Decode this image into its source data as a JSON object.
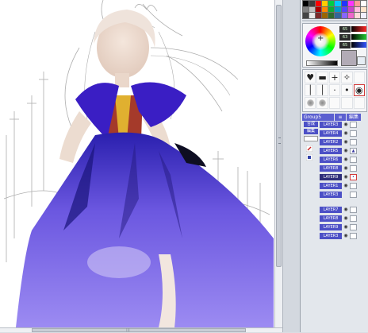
{
  "canvas": {
    "label": "illustration canvas"
  },
  "palette": {
    "swatches": [
      "#000000",
      "#3b3b3b",
      "#ff0000",
      "#ffcc00",
      "#00cc44",
      "#00c8ff",
      "#2233ff",
      "#ff33ff",
      "#ff9999",
      "#ffffff",
      "#808080",
      "#bfbfbf",
      "#aa0000",
      "#ff8800",
      "#11aa33",
      "#0099cc",
      "#5544ff",
      "#cc44cc",
      "#ffbbdd",
      "#ffe6cc",
      "#444444",
      "#e8e8e8",
      "#7a2a2a",
      "#996600",
      "#2e6b2e",
      "#336699",
      "#8866ff",
      "#ee66cc",
      "#ffd9d9",
      "#f0f0ff"
    ]
  },
  "color": {
    "r": "65",
    "g": "63",
    "b": "65",
    "r_color": "#ff2a2a",
    "g_color": "#22cc33",
    "b_color": "#3355ff",
    "main_color": "#b2abb6"
  },
  "brushes": {
    "cells": [
      "♥",
      "▬",
      "+",
      "✧",
      "",
      "│",
      "│",
      "·",
      "•",
      "◉",
      "◦",
      "◦",
      "",
      "",
      ""
    ]
  },
  "group": {
    "name": "Group5",
    "edit_label": "編集",
    "options_label": "≡"
  },
  "tools": {
    "top_button": "合成",
    "second_button": "編集"
  },
  "layers": [
    {
      "name": "LAYER3",
      "eye": "◉",
      "thumb": ""
    },
    {
      "name": "LAYER4",
      "eye": "◉",
      "thumb": ""
    },
    {
      "name": "LAYER2",
      "eye": "◉",
      "thumb": ""
    },
    {
      "name": "LAYER5",
      "eye": "◉",
      "thumb": "▲"
    },
    {
      "name": "LAYER6",
      "eye": "◉",
      "thumb": ""
    },
    {
      "name": "LAYER8",
      "eye": "◉",
      "thumb": ""
    },
    {
      "name": "LAYER9",
      "eye": "◉",
      "thumb": "•",
      "active": true,
      "selected": true
    },
    {
      "name": "LAYER1",
      "eye": "◉",
      "thumb": ""
    },
    {
      "name": "LAYER3",
      "eye": "",
      "thumb": ""
    },
    {
      "name": "LAYER7",
      "eye": "◉",
      "thumb": ""
    },
    {
      "name": "LAYER8",
      "eye": "◉",
      "thumb": ""
    },
    {
      "name": "LAYER9",
      "eye": "◉",
      "thumb": ""
    },
    {
      "name": "LAYER3",
      "eye": "◉",
      "thumb": ""
    }
  ],
  "scroll": {
    "h_grip": "⁞⁞⁞"
  }
}
